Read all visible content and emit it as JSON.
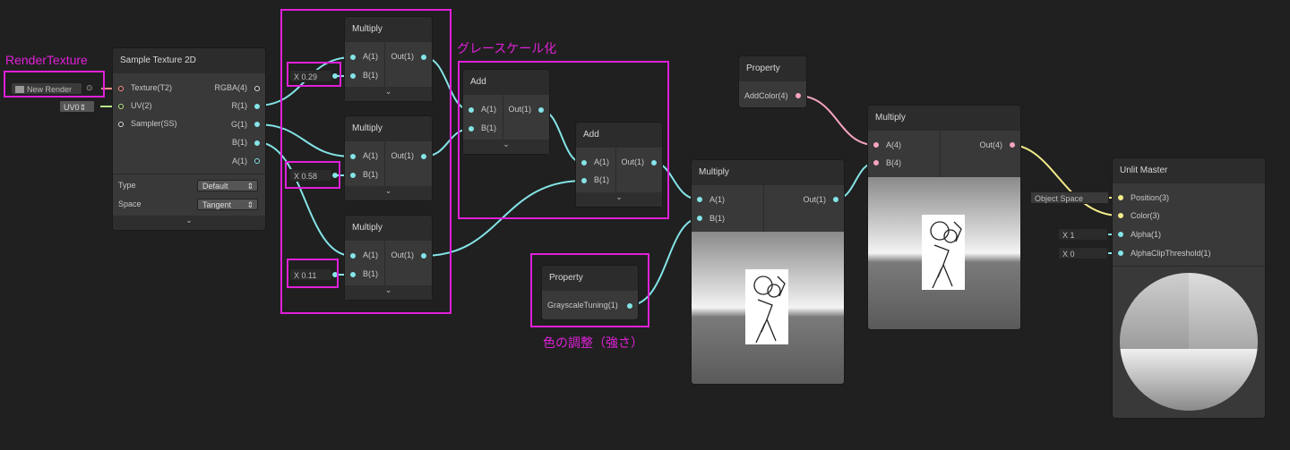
{
  "annotations": {
    "render_texture": "RenderTexture",
    "grayscale": "グレースケール化",
    "color_tuning": "色の調整（強さ）"
  },
  "render_texture_field": "New Render",
  "uv_field": "UV0",
  "sample_texture": {
    "title": "Sample Texture 2D",
    "inputs": [
      "Texture(T2)",
      "UV(2)",
      "Sampler(SS)"
    ],
    "outputs": [
      "RGBA(4)",
      "R(1)",
      "G(1)",
      "B(1)",
      "A(1)"
    ],
    "type_label": "Type",
    "type_value": "Default",
    "space_label": "Space",
    "space_value": "Tangent"
  },
  "multiply1": {
    "title": "Multiply",
    "in_a": "A(1)",
    "in_b": "B(1)",
    "out": "Out(1)",
    "const": "X  0.29"
  },
  "multiply2": {
    "title": "Multiply",
    "in_a": "A(1)",
    "in_b": "B(1)",
    "out": "Out(1)",
    "const": "X  0.58"
  },
  "multiply3": {
    "title": "Multiply",
    "in_a": "A(1)",
    "in_b": "B(1)",
    "out": "Out(1)",
    "const": "X  0.11"
  },
  "add1": {
    "title": "Add",
    "in_a": "A(1)",
    "in_b": "B(1)",
    "out": "Out(1)"
  },
  "add2": {
    "title": "Add",
    "in_a": "A(1)",
    "in_b": "B(1)",
    "out": "Out(1)"
  },
  "property_gray": {
    "title": "Property",
    "port": "GrayscaleTuning(1)"
  },
  "multiply4": {
    "title": "Multiply",
    "in_a": "A(1)",
    "in_b": "B(1)",
    "out": "Out(1)"
  },
  "property_color": {
    "title": "Property",
    "port": "AddColor(4)"
  },
  "multiply5": {
    "title": "Multiply",
    "in_a": "A(4)",
    "in_b": "B(4)",
    "out": "Out(4)"
  },
  "unlit_master": {
    "title": "Unlit Master",
    "inputs": [
      "Position(3)",
      "Color(3)",
      "Alpha(1)",
      "AlphaClipThreshold(1)"
    ],
    "position_field": "Object Space",
    "alpha_field": "X  1",
    "clip_field": "X  0"
  },
  "colors": {
    "wire_float": "#84e4e7",
    "wire_vec4": "#f6a4c0",
    "annotation": "#e020d8",
    "wire_vec3": "#f4ec8a"
  }
}
